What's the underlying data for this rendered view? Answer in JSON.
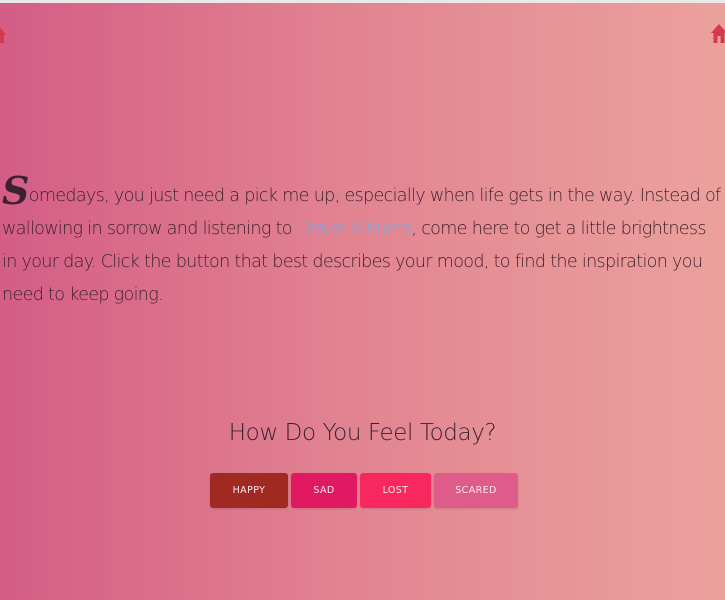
{
  "intro": {
    "dropcap": "S",
    "text_before_link": "omedays, you just need a pick me up, especially when life gets in the way. Instead of wallowing in sorrow and listening to ",
    "link_text": "Drake Albums",
    "text_after_link": ", come here to get a little brightness in your day. Click the button that best describes your mood, to find the inspiration you need to keep going."
  },
  "question": "How Do You Feel Today?",
  "buttons": {
    "happy": "HAPPY",
    "sad": "SAD",
    "lost": "LOST",
    "scared": "SCARED"
  },
  "icons": {
    "left": "home-icon",
    "right": "home-icon"
  },
  "colors": {
    "happy": "#a02a21",
    "sad": "#e01962",
    "lost": "#f8285f",
    "scared": "#df5b8a",
    "link": "#7aa7e0"
  }
}
